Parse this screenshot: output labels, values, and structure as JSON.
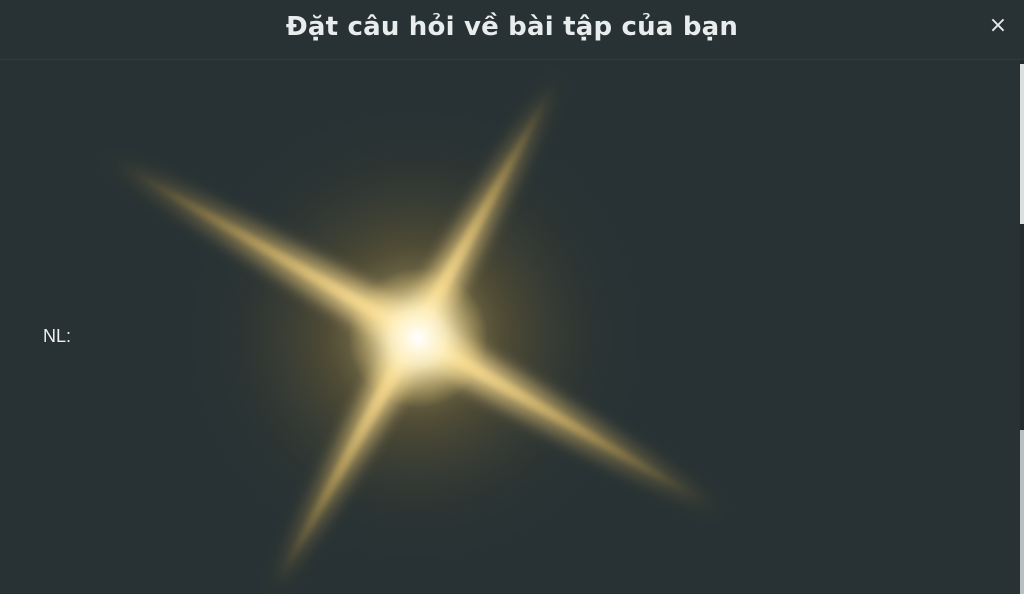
{
  "dialog": {
    "title": "Đặt câu hỏi về bài tập của bạn",
    "close_symbol": "×"
  },
  "content": {
    "label_text": "NL:",
    "background_image": "golden-sparkle-star"
  },
  "colors": {
    "background": "#283234",
    "title_text": "#e9ecec",
    "sparkle_core": "#fff6d6",
    "sparkle_glow": "#e6b84a"
  }
}
